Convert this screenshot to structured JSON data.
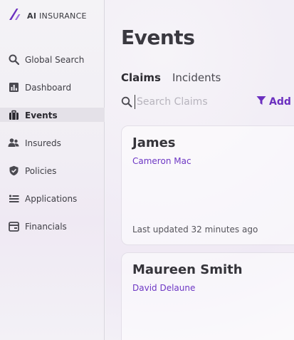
{
  "brand": {
    "prefix": "AI",
    "name": "INSURANCE"
  },
  "sidebar": {
    "items": [
      {
        "label": "Global Search",
        "icon": "search-icon",
        "active": false
      },
      {
        "label": "Dashboard",
        "icon": "bar-chart-icon",
        "active": false
      },
      {
        "label": "Events",
        "icon": "briefcase-icon",
        "active": true
      },
      {
        "label": "Insureds",
        "icon": "users-icon",
        "active": false
      },
      {
        "label": "Policies",
        "icon": "shield-check-icon",
        "active": false
      },
      {
        "label": "Applications",
        "icon": "list-icon",
        "active": false
      },
      {
        "label": "Financials",
        "icon": "wallet-icon",
        "active": false
      }
    ]
  },
  "main": {
    "title": "Events",
    "tabs": [
      {
        "label": "Claims",
        "active": true
      },
      {
        "label": "Incidents",
        "active": false
      }
    ],
    "search": {
      "placeholder": "Search Claims",
      "value": ""
    },
    "add_label": "Add",
    "cards": [
      {
        "name": "James",
        "sub": "Cameron Mac",
        "updated": "Last updated 32 minutes ago"
      },
      {
        "name": "Maureen Smith",
        "sub": "David Delaune",
        "updated": ""
      }
    ]
  },
  "colors": {
    "accent": "#6b2fbf",
    "active_bg": "#e4e1e8"
  }
}
